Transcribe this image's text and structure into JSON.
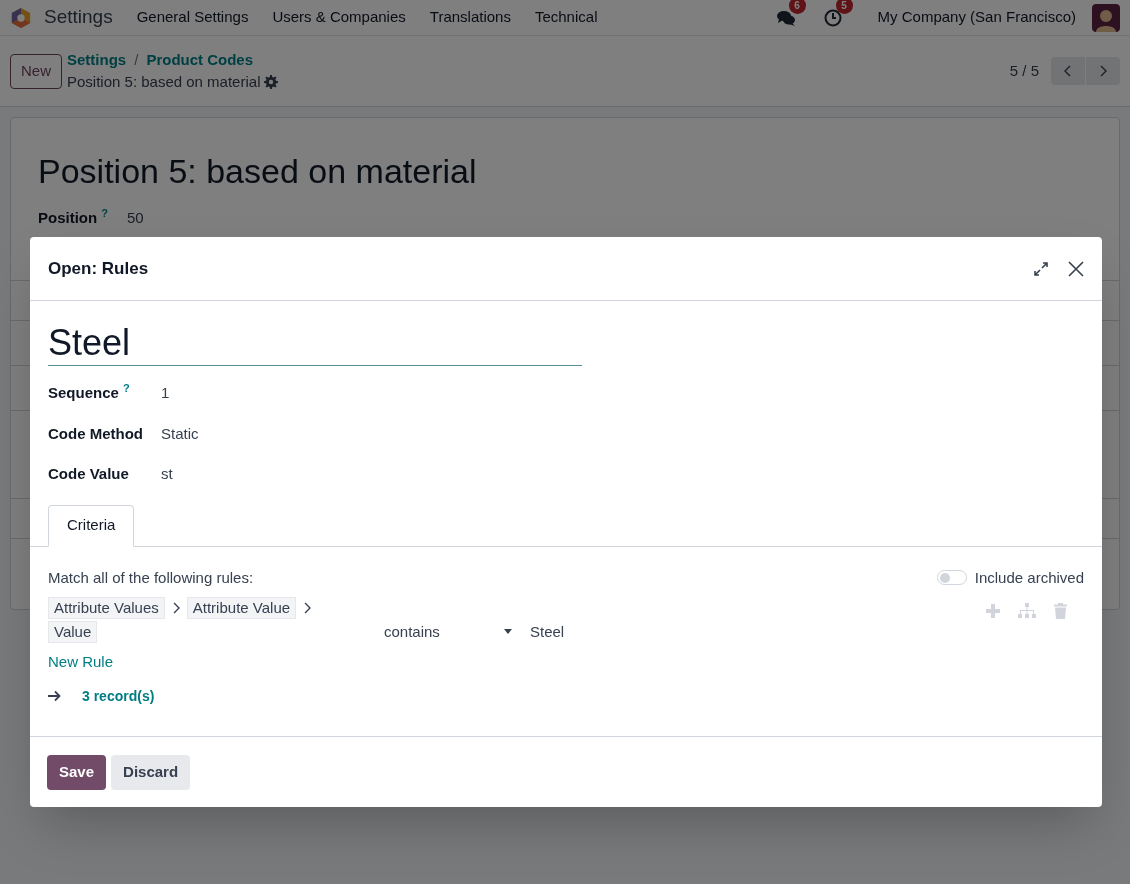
{
  "navbar": {
    "app": "Settings",
    "menu": [
      "General Settings",
      "Users & Companies",
      "Translations",
      "Technical"
    ],
    "messages_badge": "6",
    "activities_badge": "5",
    "company": "My Company (San Francisco)"
  },
  "control_panel": {
    "new_button": "New",
    "breadcrumbs": [
      "Settings",
      "Product Codes"
    ],
    "breadcrumb_separator": "/",
    "record": "Position 5: based on material",
    "pager": "5 / 5"
  },
  "form": {
    "title": "Position 5: based on material",
    "fields": [
      {
        "label": "Position",
        "help": "?",
        "value": "50"
      }
    ]
  },
  "dialog": {
    "title": "Open: Rules",
    "name": "Steel",
    "fields": [
      {
        "label": "Sequence",
        "help": "?",
        "value": "1"
      },
      {
        "label": "Code Method",
        "value": "Static"
      },
      {
        "label": "Code Value",
        "value": "st"
      }
    ],
    "tabs": [
      {
        "label": "Criteria",
        "selected": true
      }
    ],
    "domain": {
      "intro": "Match all of the following rules:",
      "include_archived": {
        "label": "Include archived",
        "on": false
      },
      "rules": [
        {
          "path": [
            "Attribute Values",
            "Attribute Value",
            "Value"
          ],
          "operator": "contains",
          "value": "Steel"
        }
      ],
      "new_rule": "New Rule",
      "records": "3 record(s)"
    },
    "buttons": [
      {
        "label": "Save",
        "kind": "primary"
      },
      {
        "label": "Discard",
        "kind": "secondary"
      }
    ]
  }
}
